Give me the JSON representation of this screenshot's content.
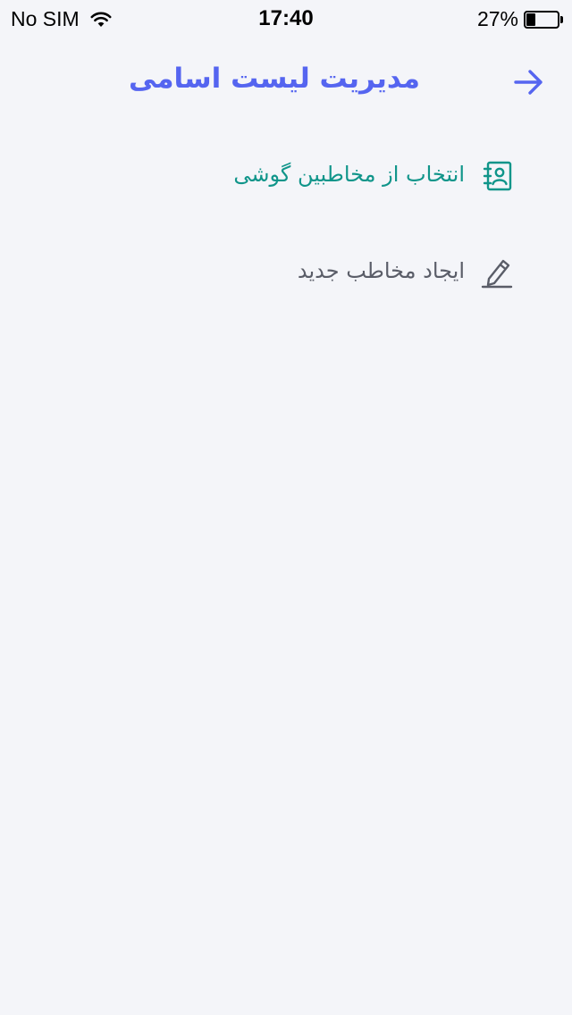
{
  "status_bar": {
    "carrier": "No SIM",
    "time": "17:40",
    "battery_percent": "27%",
    "battery_level": 0.27
  },
  "header": {
    "title": "مدیریت لیست اسامی",
    "back_icon": "arrow-right-icon",
    "accent_color": "#5565f0"
  },
  "menu": {
    "items": [
      {
        "label": "انتخاب از مخاطبین گوشی",
        "icon": "contact-book-icon",
        "color": "#10958a"
      },
      {
        "label": "ایجاد مخاطب جدید",
        "icon": "pencil-icon",
        "color": "#5a5d68"
      }
    ]
  }
}
